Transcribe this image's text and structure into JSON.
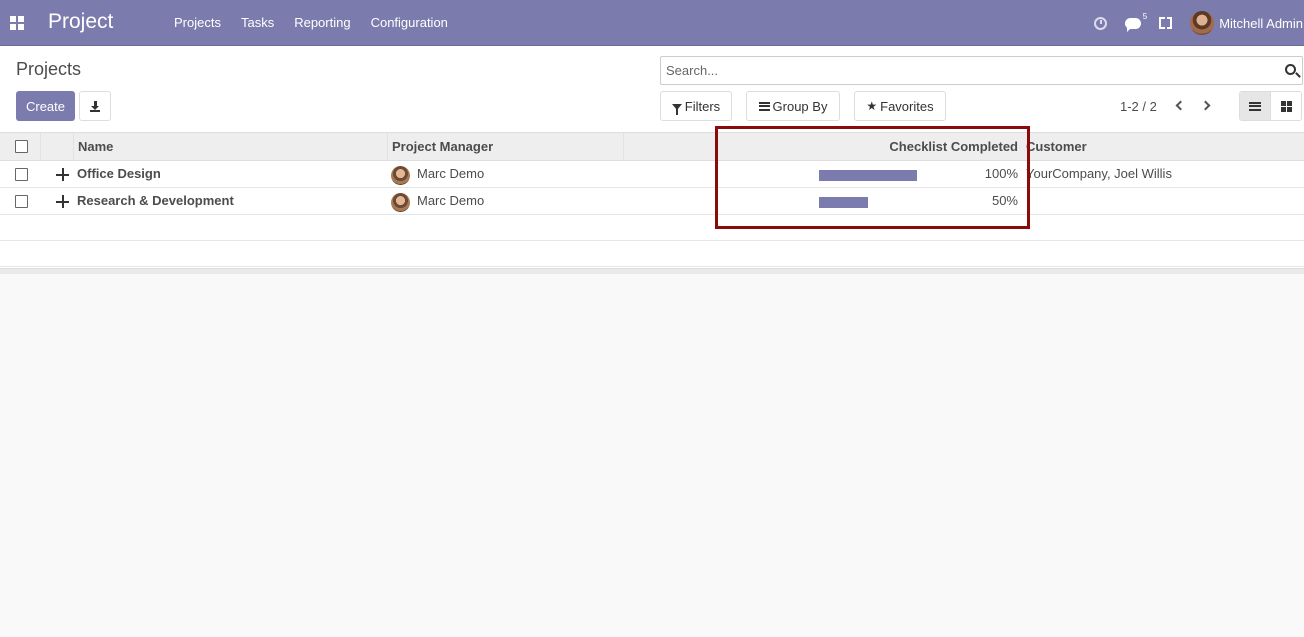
{
  "navbar": {
    "brand": "Project",
    "menu": [
      "Projects",
      "Tasks",
      "Reporting",
      "Configuration"
    ],
    "messages_badge": "5",
    "user_name": "Mitchell Admin"
  },
  "control_panel": {
    "breadcrumb": "Projects",
    "create_label": "Create",
    "search_placeholder": "Search...",
    "filters_label": "Filters",
    "group_by_label": "Group By",
    "favorites_label": "Favorites",
    "pager": "1-2 / 2"
  },
  "table": {
    "columns": {
      "name": "Name",
      "project_manager": "Project Manager",
      "checklist_completed": "Checklist Completed",
      "customer": "Customer"
    },
    "rows": [
      {
        "name": "Office Design",
        "manager": "Marc Demo",
        "progress": 100,
        "progress_label": "100%",
        "customer": "YourCompany, Joel Willis"
      },
      {
        "name": "Research & Development",
        "manager": "Marc Demo",
        "progress": 50,
        "progress_label": "50%",
        "customer": ""
      }
    ]
  },
  "colors": {
    "brand": "#7c7bad",
    "highlight": "#8b0b0b"
  }
}
